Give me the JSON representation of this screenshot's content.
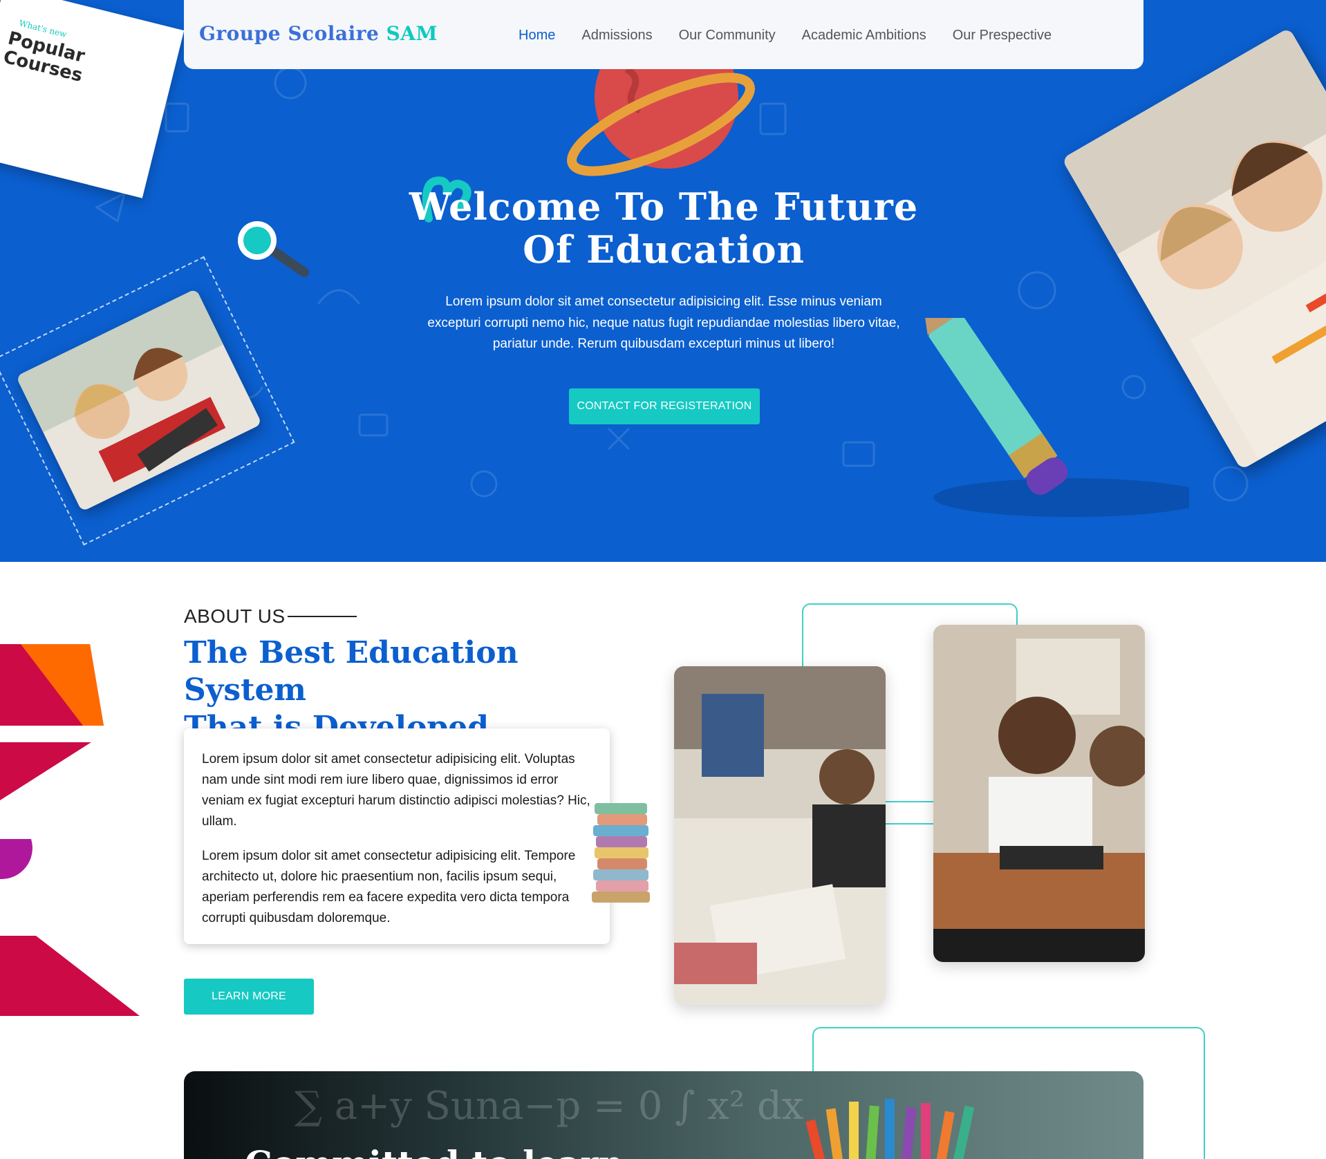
{
  "navbar": {
    "brand_part1": "Groupe Scolaire",
    "brand_part2": "SAM",
    "items": [
      {
        "label": "Home",
        "active": true
      },
      {
        "label": "Admissions",
        "active": false
      },
      {
        "label": "Our Community",
        "active": false
      },
      {
        "label": "Academic Ambitions",
        "active": false
      },
      {
        "label": "Our Prespective",
        "active": false
      }
    ]
  },
  "hero": {
    "title_line1": "Welcome To The Future",
    "title_line2": "Of Education",
    "text": "Lorem ipsum dolor sit amet consectetur adipisicing elit. Esse minus veniam excepturi corrupti nemo hic, neque natus fugit repudiandae molestias libero vitae, pariatur unde. Rerum quibusdam excepturi minus ut libero!",
    "cta": "CONTACT FOR REGISTERATION",
    "courses_card": {
      "small": "What's new",
      "title_line1": "Popular",
      "title_line2": "Courses"
    }
  },
  "about": {
    "kicker": "ABOUT US",
    "title_line1": "The Best Education System",
    "title_line2": "That is Developed",
    "para1": "Lorem ipsum dolor sit amet consectetur adipisicing elit. Voluptas nam unde sint modi rem iure libero quae, dignissimos id error veniam ex fugiat excepturi harum distinctio adipisci molestias? Hic, ullam.",
    "para2": "Lorem ipsum dolor sit amet consectetur adipisicing elit. Tempore architecto ut, dolore hic praesentium non, facilis ipsum sequi, aperiam perferendis rem ea facere expedita vero dicta tempora corrupti quibusdam doloremque.",
    "button": "LEARN MORE"
  },
  "banner": {
    "title": "Committed to learn"
  },
  "colors": {
    "primary": "#0b5fcf",
    "accent": "#16c9c3",
    "outline": "#3fd0c8",
    "deco_crimson": "#cc0a45",
    "deco_orange": "#ff6a00",
    "deco_magenta": "#b0189c"
  }
}
